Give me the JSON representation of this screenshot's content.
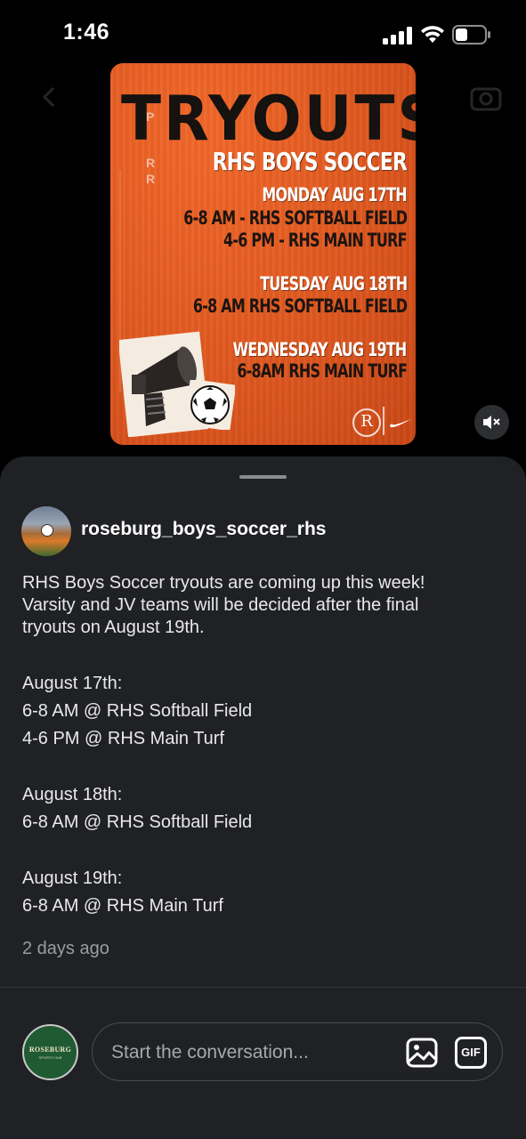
{
  "status_bar": {
    "time": "1:46"
  },
  "poster": {
    "title": "TRYOUTS",
    "subtitle": "RHS BOYS SOCCER",
    "day1": "MONDAY AUG 17TH",
    "day1_line1": "6-8 AM - RHS SOFTBALL FIELD",
    "day1_line2": "4-6 PM - RHS MAIN TURF",
    "day2": "TUESDAY AUG 18TH",
    "day2_line1": "6-8 AM RHS SOFTBALL FIELD",
    "day3": "WEDNESDAY AUG 19TH",
    "day3_line1": "6-8AM RHS MAIN TURF",
    "logo_letter": "R"
  },
  "post": {
    "username": "roseburg_boys_soccer_rhs",
    "caption": [
      "RHS Boys Soccer tryouts are coming up this week!",
      "Varsity and JV teams will be decided after the final",
      "tryouts on August 19th."
    ],
    "schedule": [
      "August 17th:",
      "6-8 AM @ RHS Softball Field",
      "4-6 PM @ RHS Main Turf",
      "August 18th:",
      "6-8 AM @ RHS Softball Field",
      "August 19th:",
      "6-8 AM @ RHS Main Turf"
    ],
    "time_ago": "2 days ago"
  },
  "composer": {
    "avatar_brand": "ROSEBURG",
    "avatar_sub": "SPORTS HUB",
    "placeholder": "Start the conversation...",
    "gif_label": "GIF"
  }
}
